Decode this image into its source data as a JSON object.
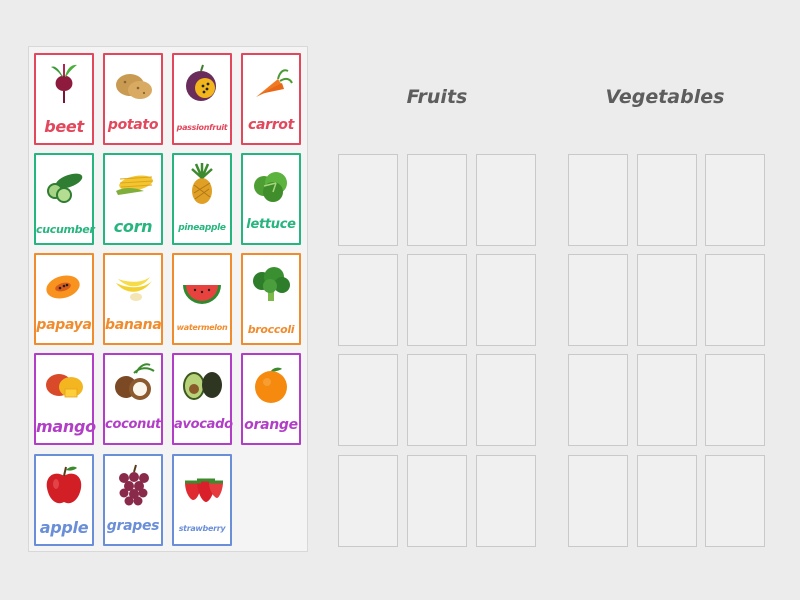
{
  "headings": {
    "fruits": "Fruits",
    "vegetables": "Vegetables"
  },
  "colors": {
    "background": "#ececec",
    "row1": "#e2475c",
    "row2": "#27b57f",
    "row3": "#f08c2e",
    "row4": "#b23ec7",
    "row5": "#6a8fd8",
    "heading": "#5d5d5d"
  },
  "cards": [
    {
      "label": "beet",
      "icon": "beet-icon",
      "row": 1
    },
    {
      "label": "potato",
      "icon": "potato-icon",
      "row": 1
    },
    {
      "label": "passionfruit",
      "icon": "passionfruit-icon",
      "row": 1
    },
    {
      "label": "carrot",
      "icon": "carrot-icon",
      "row": 1
    },
    {
      "label": "cucumber",
      "icon": "cucumber-icon",
      "row": 2
    },
    {
      "label": "corn",
      "icon": "corn-icon",
      "row": 2
    },
    {
      "label": "pineapple",
      "icon": "pineapple-icon",
      "row": 2
    },
    {
      "label": "lettuce",
      "icon": "lettuce-icon",
      "row": 2
    },
    {
      "label": "papaya",
      "icon": "papaya-icon",
      "row": 3
    },
    {
      "label": "banana",
      "icon": "banana-icon",
      "row": 3
    },
    {
      "label": "watermelon",
      "icon": "watermelon-icon",
      "row": 3
    },
    {
      "label": "broccoli",
      "icon": "broccoli-icon",
      "row": 3
    },
    {
      "label": "mango",
      "icon": "mango-icon",
      "row": 4
    },
    {
      "label": "coconut",
      "icon": "coconut-icon",
      "row": 4
    },
    {
      "label": "avocado",
      "icon": "avocado-icon",
      "row": 4
    },
    {
      "label": "orange",
      "icon": "orange-icon",
      "row": 4
    },
    {
      "label": "apple",
      "icon": "apple-icon",
      "row": 5
    },
    {
      "label": "grapes",
      "icon": "grapes-icon",
      "row": 5
    },
    {
      "label": "strawberry",
      "icon": "strawberry-icon",
      "row": 5
    }
  ]
}
